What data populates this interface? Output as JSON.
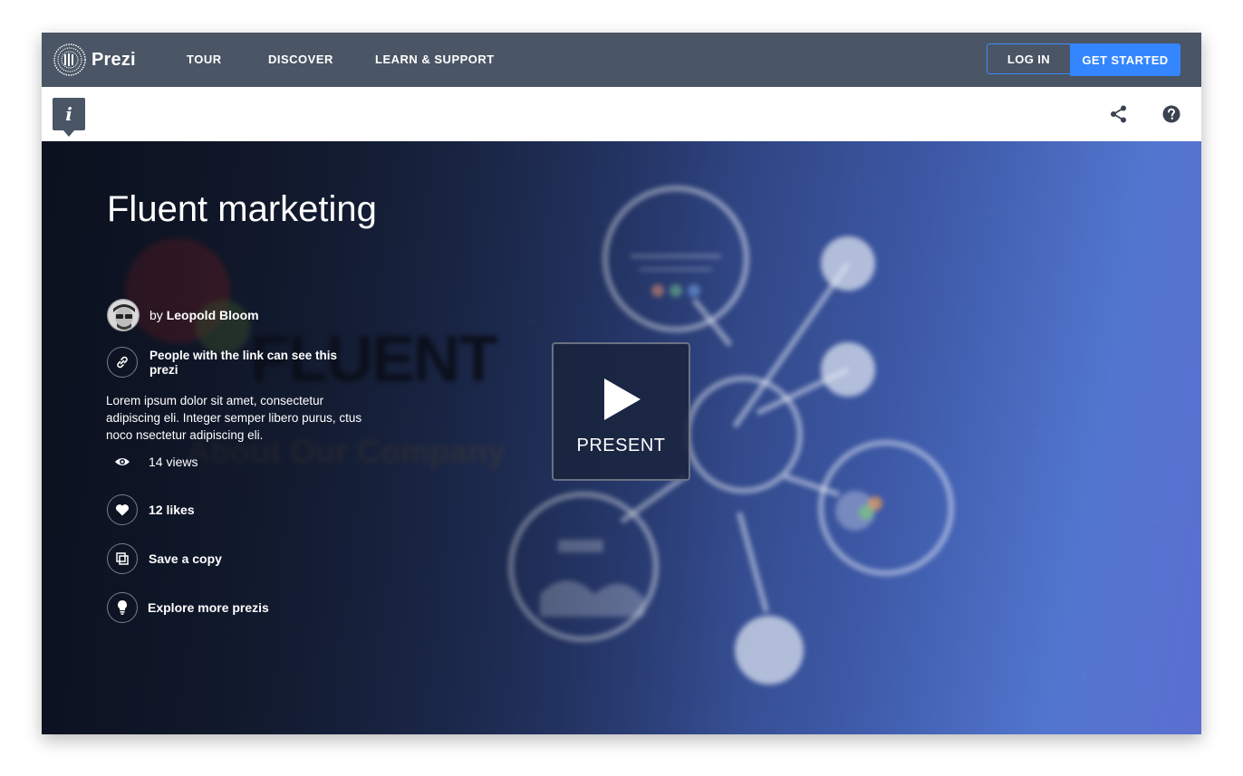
{
  "nav": {
    "logo_text": "Prezi",
    "links": [
      "TOUR",
      "DISCOVER",
      "LEARN & SUPPORT"
    ],
    "login_label": "LOG IN",
    "get_started_label": "GET STARTED"
  },
  "toolbar": {
    "info_label": "i"
  },
  "presentation": {
    "title": "Fluent marketing",
    "author_prefix": "by",
    "author_name": "Leopold Bloom",
    "visibility": "People with the link can see this prezi",
    "description": "Lorem ipsum dolor sit amet, consectetur adipiscing eli. Integer semper libero purus, ctus noco nsectetur adipiscing eli.",
    "views": "14 views",
    "likes": "12 likes",
    "save_copy": "Save a copy",
    "explore": "Explore more prezis",
    "present_label": "PRESENT"
  },
  "background_text": {
    "brand": "FLUENT",
    "tagline": "About Our Company"
  },
  "colors": {
    "nav_bg": "#4a5565",
    "accent": "#3486ff",
    "white": "#ffffff"
  },
  "icons": [
    "prezi-logo-icon",
    "info-icon",
    "share-icon",
    "help-icon",
    "link-icon",
    "eye-icon",
    "heart-icon",
    "copy-icon",
    "lightbulb-icon",
    "play-icon"
  ]
}
